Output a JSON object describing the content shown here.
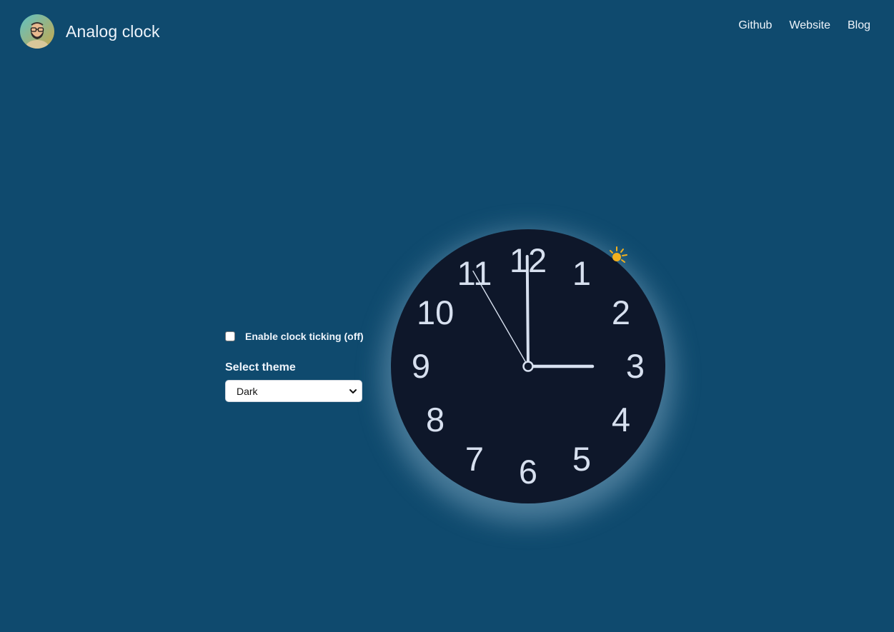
{
  "header": {
    "title": "Analog clock",
    "avatar_icon": "bearded-man-avatar-icon",
    "nav": [
      {
        "label": "Github"
      },
      {
        "label": "Website"
      },
      {
        "label": "Blog"
      }
    ]
  },
  "controls": {
    "ticking_checked": false,
    "ticking_label": "Enable clock ticking (off)",
    "theme_label": "Select theme",
    "theme_selected": "Dark"
  },
  "clock": {
    "numbers": [
      "12",
      "1",
      "2",
      "3",
      "4",
      "5",
      "6",
      "7",
      "8",
      "9",
      "10",
      "11"
    ],
    "time": {
      "hour": 3,
      "minute": 59,
      "second": 55
    },
    "face_color": "#0e172a",
    "hand_color": "#d7e0ef",
    "weather_icon": "sun-icon",
    "sun_color": "#f2b01e"
  },
  "colors": {
    "background": "#0f4a6e",
    "text": "#eef4fb"
  }
}
